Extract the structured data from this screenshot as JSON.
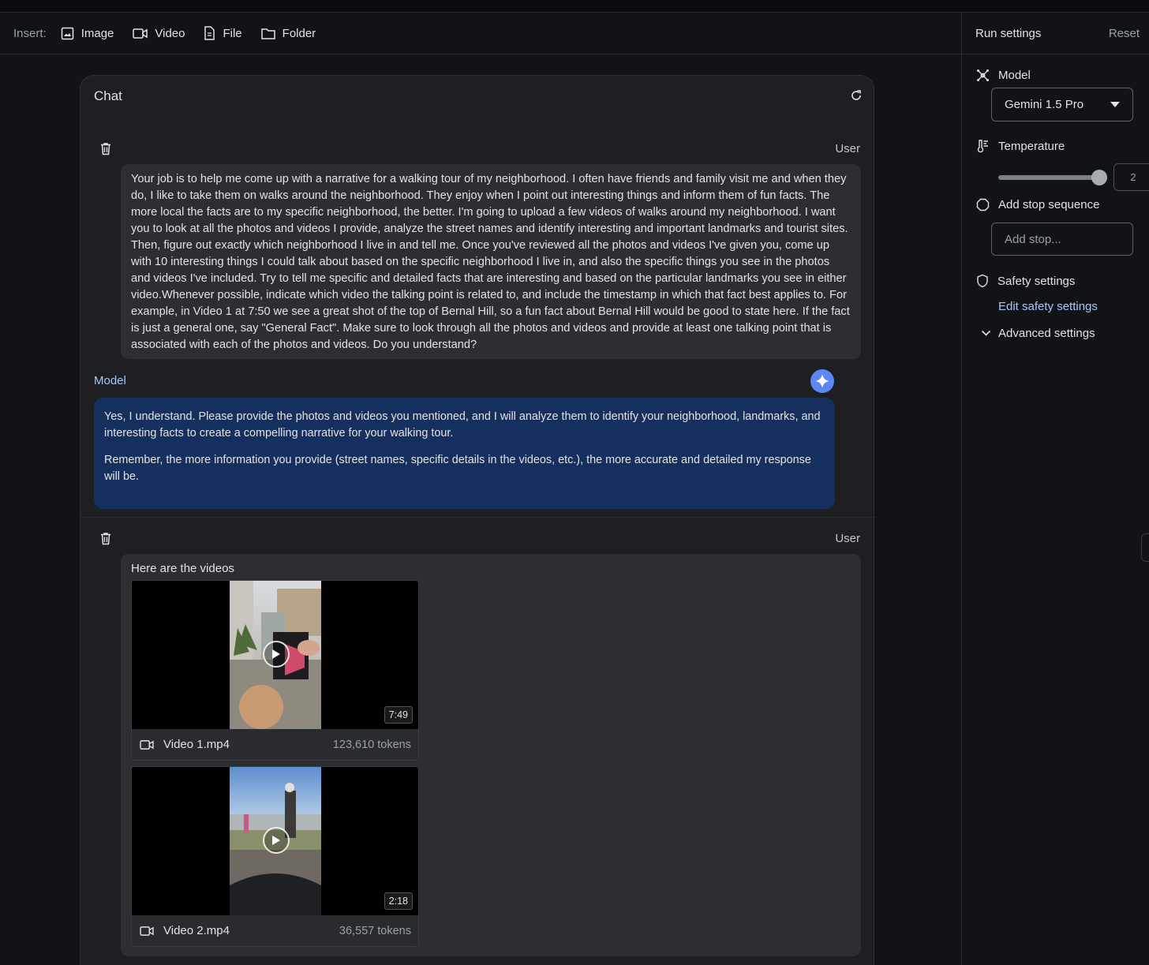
{
  "toolbar": {
    "insert_label": "Insert:",
    "items": [
      {
        "label": "Image",
        "icon": "image-icon"
      },
      {
        "label": "Video",
        "icon": "video-icon"
      },
      {
        "label": "File",
        "icon": "file-icon"
      },
      {
        "label": "Folder",
        "icon": "folder-icon"
      }
    ]
  },
  "chat": {
    "title": "Chat",
    "turns": [
      {
        "role": "User",
        "text": "Your job is to help me come up with a narrative for a walking tour of my neighborhood. I often have friends and family visit me and when they do, I like to take them on walks around the neighborhood. They enjoy when I point out interesting things and inform them of fun facts. The more local the facts are to my specific neighborhood, the better. I'm going to upload a few videos of walks around my neighborhood. I want you to look at all the photos and videos I provide, analyze the street names and identify interesting and important landmarks and tourist sites. Then, figure out exactly which neighborhood I live in and tell me. Once you've reviewed all the photos and videos I've given you, come up with 10 interesting things I could talk about based on the specific neighborhood I live in, and also the specific things you see in the photos and videos I've included. Try to tell me specific and detailed facts that are interesting and based on the particular landmarks you see in either video.Whenever possible, indicate which video the talking point is related to, and include the timestamp in which that fact best applies to. For example, in Video 1 at 7:50 we see a great shot of the top of Bernal Hill, so a fun fact about Bernal Hill would be good to state here. If the fact is just a general one, say \"General Fact\". Make sure to look through all the photos and videos and provide at least one talking point that is associated with each of the photos and videos. Do you understand?"
      },
      {
        "role": "Model",
        "paragraphs": [
          "Yes, I understand. Please provide the photos and videos you mentioned, and I will analyze them to identify your neighborhood, landmarks, and interesting facts to create a compelling narrative for your walking tour.",
          "Remember, the more information you provide (street names, specific details in the videos, etc.), the more accurate and detailed my response will be."
        ]
      },
      {
        "role": "User",
        "text": "Here are the videos",
        "videos": [
          {
            "name": "Video 1.mp4",
            "tokens": "123,610 tokens",
            "duration": "7:49"
          },
          {
            "name": "Video 2.mp4",
            "tokens": "36,557 tokens",
            "duration": "2:18"
          }
        ]
      }
    ]
  },
  "settings": {
    "title": "Run settings",
    "reset": "Reset",
    "model_label": "Model",
    "model_value": "Gemini 1.5 Pro",
    "temperature_label": "Temperature",
    "temperature_value": "2",
    "stop_label": "Add stop sequence",
    "stop_placeholder": "Add stop...",
    "safety_label": "Safety settings",
    "safety_link": "Edit safety settings",
    "advanced_label": "Advanced settings"
  },
  "colors": {
    "accent": "#a8c7fa",
    "model_bubble": "#15305e",
    "gem": "#5e86f5"
  }
}
